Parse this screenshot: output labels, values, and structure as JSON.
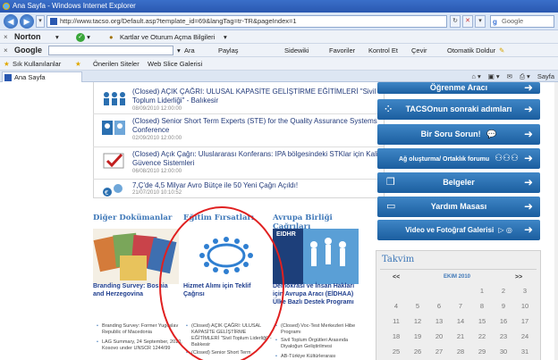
{
  "window": {
    "title": "Ana Sayfa - Windows Internet Explorer"
  },
  "address": {
    "url": "http://www.tacso.org/Default.asp?template_id=69&langTag=tr-TR&pageIndex=1",
    "search_placeholder": "Google"
  },
  "norton_bar": {
    "brand": "Norton",
    "item": "Kartlar ve Oturum Açma Bilgileri"
  },
  "google_bar": {
    "brand": "Google",
    "items": [
      "Ara",
      "Paylaş",
      "Sidewiki",
      "Favoriler",
      "Kontrol Et",
      "Çevir",
      "Otomatik Doldur"
    ]
  },
  "favorites_bar": {
    "items": [
      "Sık Kullanılanlar",
      "Önerilen Siteler",
      "Web Slice Galerisi"
    ]
  },
  "tabs": {
    "active": "Ana Sayfa",
    "tools": [
      "Sayfa"
    ]
  },
  "announcements": [
    {
      "title": "(Closed) AÇIK ÇAĞRI: ULUSAL KAPASİTE GELİŞTİRME EĞİTİMLERİ \"Sivil Toplum Liderliği\" - Balıkesir",
      "date": "08/09/2010 12:00:00"
    },
    {
      "title": "(Closed) Senior Short Term Experts (STE) for the Quality Assurance Systems Conference",
      "date": "02/09/2010 12:00:00"
    },
    {
      "title": "(Closed) Açık Çağrı: Uluslararası Konferans: IPA bölgesindeki STKlar için Kalite Güvence Sistemleri",
      "date": "06/08/2010 12:00:00"
    },
    {
      "title": "7,Ç'de 4,5 Milyar Avro Bütçe ile 50 Yeni Çağrı Açıldı!",
      "date": "21/07/2010 10:10:52"
    }
  ],
  "sections": {
    "col1": {
      "heading": "Diğer Dokümanlar",
      "title": "Branding Survey: Bosnia and Herzegovina",
      "bullets": [
        "Branding Survey: Former Yugoslav Republic of Macedonia",
        "LAG Summary, 24 September, 2010, Kosovo under UNSCR 1244/99"
      ]
    },
    "col2": {
      "heading": "Eğitim Fırsatları",
      "title": "Hizmet Alımı için Teklif Çağrısı",
      "bullets": [
        "(Closed) AÇIK ÇAĞRI: ULUSAL KAPASİTE GELİŞTİRME EĞİTİMLERİ \"Sivil Toplum Liderliği\" - Balıkesir",
        "(Closed) Senior Short Term"
      ]
    },
    "col3": {
      "heading": "Avrupa Birliği Çağrıları",
      "image_text": "EIDHR",
      "title": "Demokrasi ve İnsan Hakları için Avrupa Aracı (EİDHAA) Ülke Bazlı Destek Programı",
      "bullets": [
        "(Closed) Voc-Test Merkezleri Hibe Programı",
        "Sivil Toplum Örgütleri Arasında Diyaloğun Geliştirilmesi",
        "AB-Türkiye Kültürlerarası"
      ]
    }
  },
  "right_buttons": [
    "Öğrenme Aracı",
    "TACSOnun sonraki adımları",
    "Bir Soru Sorun!",
    "Ağ oluşturma/ Ortaklık forumu",
    "Belgeler",
    "Yardım Masası",
    "Video ve Fotoğraf Galerisi"
  ],
  "calendar": {
    "title": "Takvim",
    "prev": "<<",
    "next": ">>",
    "month": "EKIM 2010",
    "rows": [
      [
        "",
        "",
        "",
        "",
        "1",
        "2",
        "3"
      ],
      [
        "4",
        "5",
        "6",
        "7",
        "8",
        "9",
        "10"
      ],
      [
        "11",
        "12",
        "13",
        "14",
        "15",
        "16",
        "17"
      ],
      [
        "18",
        "19",
        "20",
        "21",
        "22",
        "23",
        "24"
      ],
      [
        "25",
        "26",
        "27",
        "28",
        "29",
        "30",
        "31"
      ]
    ]
  },
  "colors": {
    "accent": "#3f78b8",
    "button": "#2a6fb0",
    "highlight_circle": "#e02020"
  }
}
